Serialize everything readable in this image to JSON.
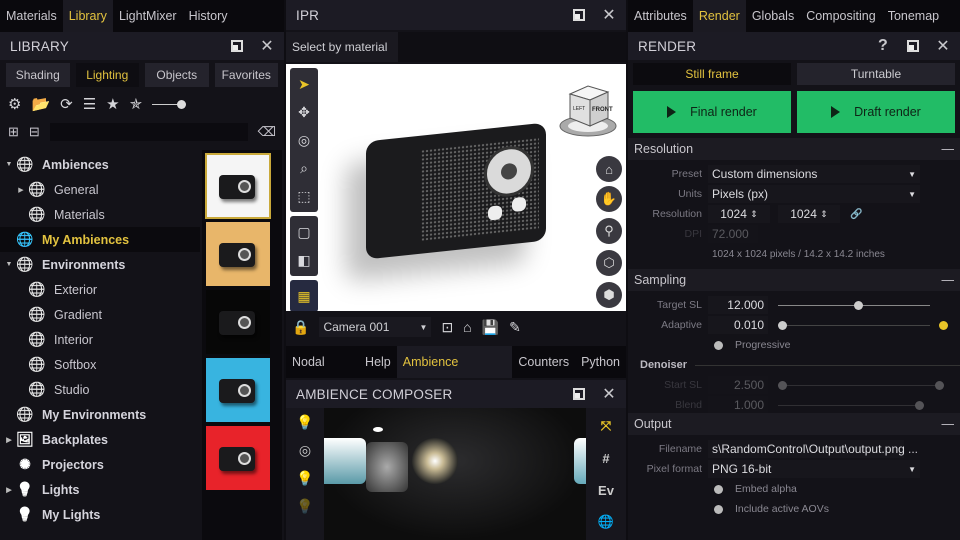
{
  "left": {
    "tabs": [
      "Materials",
      "Library",
      "LightMixer",
      "History"
    ],
    "active_tab": 1,
    "title": "LIBRARY",
    "subtabs": [
      "Shading",
      "Lighting",
      "Objects",
      "Favorites"
    ],
    "active_subtab": 1,
    "toolbar_icons": [
      "gear-icon",
      "folder-open-icon",
      "refresh-icon",
      "list-icon",
      "star-icon",
      "star-remove-icon"
    ],
    "search_placeholder": "",
    "tree": [
      {
        "label": "Ambiences",
        "level": 0,
        "bold": true,
        "expand": "open",
        "icon": "globe-lock-icon"
      },
      {
        "label": "General",
        "level": 1,
        "bold": false,
        "expand": "closed",
        "icon": "globe-lock-icon"
      },
      {
        "label": "Materials",
        "level": 1,
        "bold": false,
        "expand": "",
        "icon": "globe-lock-icon"
      },
      {
        "label": "My Ambiences",
        "level": 0,
        "bold": true,
        "expand": "",
        "icon": "globe-icon",
        "selected": true
      },
      {
        "label": "Environments",
        "level": 0,
        "bold": true,
        "expand": "open",
        "icon": "globe-lock-icon"
      },
      {
        "label": "Exterior",
        "level": 1,
        "bold": false,
        "expand": "",
        "icon": "globe-lock-icon"
      },
      {
        "label": "Gradient",
        "level": 1,
        "bold": false,
        "expand": "",
        "icon": "globe-lock-icon"
      },
      {
        "label": "Interior",
        "level": 1,
        "bold": false,
        "expand": "",
        "icon": "globe-lock-icon"
      },
      {
        "label": "Softbox",
        "level": 1,
        "bold": false,
        "expand": "",
        "icon": "globe-lock-icon"
      },
      {
        "label": "Studio",
        "level": 1,
        "bold": false,
        "expand": "",
        "icon": "globe-lock-icon"
      },
      {
        "label": "My Environments",
        "level": 0,
        "bold": true,
        "expand": "",
        "icon": "globe-icon"
      },
      {
        "label": "Backplates",
        "level": 0,
        "bold": true,
        "expand": "closed",
        "icon": "backplate-icon"
      },
      {
        "label": "Projectors",
        "level": 0,
        "bold": true,
        "expand": "",
        "icon": "projector-icon"
      },
      {
        "label": "Lights",
        "level": 0,
        "bold": true,
        "expand": "closed",
        "icon": "bulb-lock-icon"
      },
      {
        "label": "My Lights",
        "level": 0,
        "bold": true,
        "expand": "",
        "icon": "bulb-icon"
      }
    ],
    "thumbnails": [
      {
        "bg": "#f5f5f5",
        "selected": true
      },
      {
        "bg": "#e8b66a",
        "selected": false
      },
      {
        "bg": "#070707",
        "selected": false
      },
      {
        "bg": "#38b4e0",
        "selected": false
      },
      {
        "bg": "#e8232a",
        "selected": false
      }
    ]
  },
  "ipr": {
    "title": "IPR",
    "select_mode": "Select by material",
    "cube_labels": [
      "LEFT",
      "FRONT"
    ],
    "camera": "Camera 001",
    "bottom_tabs": [
      "Nodal Editor",
      "Help",
      "Ambience Composer",
      "Counters",
      "Python"
    ],
    "active_bottom_tab": 2,
    "composer_title": "AMBIENCE COMPOSER",
    "composer_right_buttons": [
      "gizmo-icon",
      "grid-icon",
      "Ev",
      "globe-icon"
    ]
  },
  "right": {
    "tabs": [
      "Attributes",
      "Render",
      "Globals",
      "Compositing",
      "Tonemap"
    ],
    "active_tab": 1,
    "title": "RENDER",
    "help": "?",
    "modes": [
      "Still frame",
      "Turntable"
    ],
    "active_mode": 0,
    "final_render": "Final render",
    "draft_render": "Draft render",
    "resolution": {
      "header": "Resolution",
      "preset_label": "Preset",
      "preset_value": "Custom dimensions",
      "units_label": "Units",
      "units_value": "Pixels (px)",
      "res_label": "Resolution",
      "width": "1024",
      "height": "1024",
      "dpi_label": "DPI",
      "dpi_value": "72.000",
      "summary": "1024 x 1024 pixels  /  14.2 x 14.2 inches"
    },
    "sampling": {
      "header": "Sampling",
      "target_label": "Target SL",
      "target_value": "12.000",
      "target_fraction": 0.5,
      "adaptive_label": "Adaptive",
      "adaptive_value": "0.010",
      "adaptive_fraction": 0.0,
      "progressive_label": "Progressive",
      "denoiser_label": "Denoiser",
      "start_label": "Start SL",
      "start_value": "2.500",
      "blend_label": "Blend",
      "blend_value": "1.000"
    },
    "output": {
      "header": "Output",
      "filename_label": "Filename",
      "filename_value": "s\\RandomControl\\Output\\output.png",
      "browse": "...",
      "format_label": "Pixel format",
      "format_value": "PNG 16-bit",
      "embed_alpha": "Embed alpha",
      "include_aovs": "Include active AOVs"
    }
  },
  "colors": {
    "accent": "#e2c23f",
    "render_green": "#22bc66"
  }
}
